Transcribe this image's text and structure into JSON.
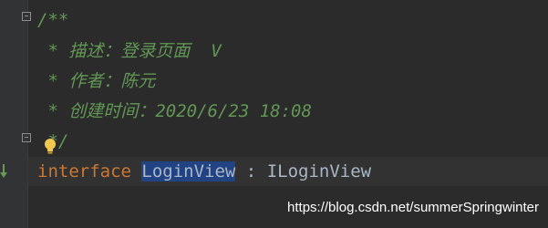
{
  "editor": {
    "doc_lines": [
      "/**",
      " * 描述：登录页面  V",
      " * 作者：陈元",
      " * 创建时间：2020/6/23 18:08",
      " */"
    ],
    "declaration": {
      "keyword": "interface",
      "name": "LoginView",
      "separator": " : ",
      "super": "ILoginView"
    }
  },
  "gutter": {
    "icons": [
      "fold-icon",
      "unfold-icon",
      "lightbulb-icon",
      "implemented-icon"
    ]
  },
  "watermark": "https://blog.csdn.net/summerSpringwinter",
  "colors": {
    "background": "#2b2b2b",
    "comment": "#629755",
    "keyword": "#cc7832",
    "identifier": "#a9b7c6",
    "selection": "#214283"
  }
}
